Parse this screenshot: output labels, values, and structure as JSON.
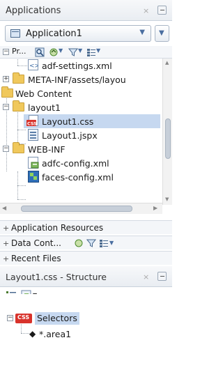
{
  "applications_panel": {
    "title": "Applications",
    "close_glyph": "×",
    "app_selector": {
      "label": "Application1",
      "arrow": "▼"
    },
    "side_button_glyph": "▼"
  },
  "projects_toolbar": {
    "label": "Pr...",
    "filter_glyph": "▼",
    "menu_glyph": "▼"
  },
  "tree": [
    {
      "label": "adf-settings.xml",
      "icon": "xml-file-icon"
    },
    {
      "label": "META-INF/assets/layou",
      "icon": "folder-icon"
    },
    {
      "label": "Web Content",
      "icon": "folder-icon"
    },
    {
      "label": "layout1",
      "icon": "folder-icon"
    },
    {
      "label": "Layout1.css",
      "icon": "css-file-icon"
    },
    {
      "label": "Layout1.jspx",
      "icon": "jspx-file-icon"
    },
    {
      "label": "WEB-INF",
      "icon": "folder-icon"
    },
    {
      "label": "adfc-config.xml",
      "icon": "xml-file-icon"
    },
    {
      "label": "faces-config.xml",
      "icon": "xml-file-icon"
    }
  ],
  "sections": {
    "application_resources": "Application Resources",
    "data_controls": "Data Cont...",
    "recent_files": "Recent Files"
  },
  "structure_panel": {
    "title": "Layout1.css - Structure",
    "close_glyph": "×",
    "selectors_label": "Selectors",
    "css_badge": "CSS",
    "selector_item": "*.area1"
  },
  "colors": {
    "selection": "#c6d8f0",
    "header_bg": "#e9edf2"
  }
}
